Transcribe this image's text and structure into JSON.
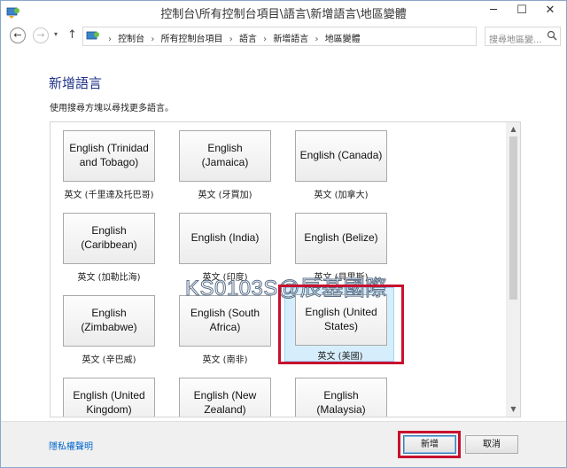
{
  "window": {
    "title": "控制台\\所有控制台項目\\語言\\新增語言\\地區變體",
    "minimize": "─",
    "maximize": "☐",
    "close": "✕"
  },
  "addressbar": {
    "back": "←",
    "forward": "→",
    "dropdown": "▾",
    "up": "↑",
    "breadcrumb": [
      "控制台",
      "所有控制台項目",
      "語言",
      "新增語言",
      "地區變體"
    ],
    "separator": "›",
    "refresh": "↻",
    "search_placeholder": "搜尋地區變..."
  },
  "content": {
    "heading": "新增語言",
    "instructions": "使用搜尋方塊以尋找更多語言。",
    "languages": [
      {
        "name": "English (Trinidad and Tobago)",
        "label": "英文 (千里達及托巴哥)"
      },
      {
        "name": "English (Jamaica)",
        "label": "英文 (牙買加)"
      },
      {
        "name": "English (Canada)",
        "label": "英文 (加拿大)"
      },
      {
        "name": "English (Caribbean)",
        "label": "英文 (加勒比海)"
      },
      {
        "name": "English (India)",
        "label": "英文 (印度)"
      },
      {
        "name": "English (Belize)",
        "label": "英文 (貝里斯)"
      },
      {
        "name": "English (Zimbabwe)",
        "label": "英文 (辛巴威)"
      },
      {
        "name": "English (South Africa)",
        "label": "英文 (南非)"
      },
      {
        "name": "English (United States)",
        "label": "英文 (美國)",
        "selected": true
      },
      {
        "name": "English (United Kingdom)",
        "label": ""
      },
      {
        "name": "English (New Zealand)",
        "label": ""
      },
      {
        "name": "English (Malaysia)",
        "label": ""
      }
    ],
    "scroll_up": "▲",
    "scroll_down": "▼",
    "watermark": "KS0103S@辰基國際"
  },
  "footer": {
    "privacy_link": "隱私權聲明",
    "add_button": "新增",
    "cancel_button": "取消"
  },
  "colors": {
    "heading": "#1e3287",
    "link": "#0066cc",
    "highlight": "#c8102e",
    "selected_bg": "#d6eefc"
  }
}
